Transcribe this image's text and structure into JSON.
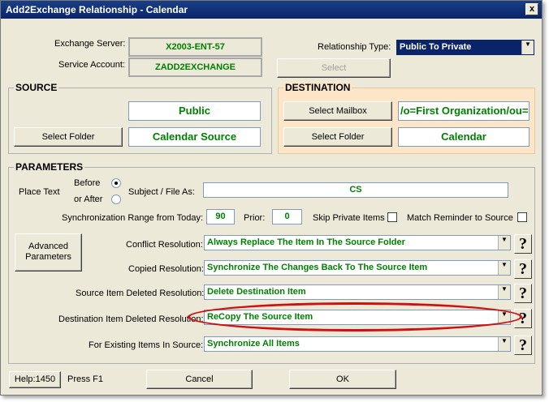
{
  "window": {
    "title": "Add2Exchange Relationship - Calendar",
    "close_glyph": "x"
  },
  "top": {
    "exchange_server_label": "Exchange Server:",
    "exchange_server_value": "X2003-ENT-57",
    "service_account_label": "Service Account:",
    "service_account_value": "ZADD2EXCHANGE",
    "relationship_type_label": "Relationship Type:",
    "relationship_type_value": "Public To Private",
    "select_label": "Select"
  },
  "source": {
    "title": "SOURCE",
    "mailbox_value": "Public",
    "select_folder_label": "Select Folder",
    "folder_value": "Calendar Source"
  },
  "destination": {
    "title": "DESTINATION",
    "select_mailbox_label": "Select Mailbox",
    "mailbox_value": "/o=First Organization/ou=",
    "select_folder_label": "Select Folder",
    "folder_value": "Calendar"
  },
  "parameters": {
    "title": "PARAMETERS",
    "place_text_label": "Place Text",
    "before_label": "Before",
    "or_after_label": "or After",
    "subject_label": "Subject  /  File As:",
    "subject_value": "CS",
    "sync_range_label": "Synchronization Range from Today:",
    "sync_range_value": "90",
    "prior_label": "Prior:",
    "prior_value": "0",
    "skip_private_label": "Skip Private Items",
    "match_reminder_label": "Match Reminder to Source",
    "advanced_label_1": "Advanced",
    "advanced_label_2": "Parameters",
    "conflict_label": "Conflict Resolution:",
    "conflict_value": "Always Replace The Item In The Source Folder",
    "copied_label": "Copied Resolution:",
    "copied_value": "Synchronize The Changes Back To The Source Item",
    "source_deleted_label": "Source Item Deleted Resolution:",
    "source_deleted_value": "Delete Destination Item",
    "dest_deleted_label": "Destination Item Deleted Resolution:",
    "dest_deleted_value": "ReCopy The Source Item",
    "existing_label": "For Existing Items In Source:",
    "existing_value": "Synchronize All Items",
    "help_glyph": "?"
  },
  "footer": {
    "help_label": "Help:1450",
    "press_f1": "Press F1",
    "cancel_label": "Cancel",
    "ok_label": "OK"
  },
  "colors": {
    "value_green": "#008000",
    "title_blue": "#0a246a",
    "highlight_red": "#d01010"
  }
}
